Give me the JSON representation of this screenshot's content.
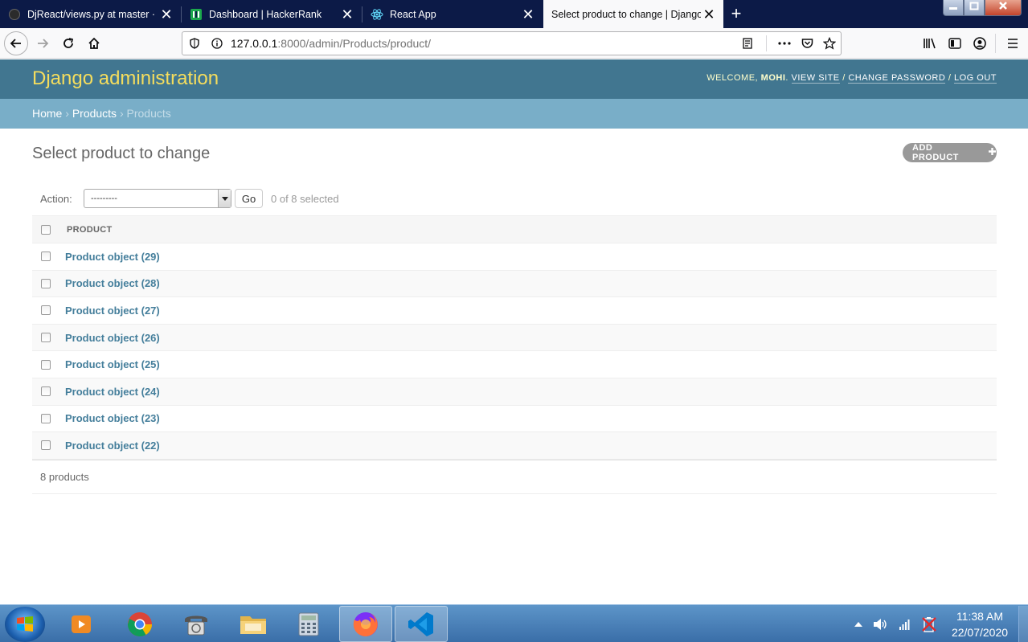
{
  "browser": {
    "tabs": [
      {
        "title": "DjReact/views.py at master · m",
        "icon": "github-icon"
      },
      {
        "title": "Dashboard | HackerRank",
        "icon": "hackerrank-icon"
      },
      {
        "title": "React App",
        "icon": "react-icon"
      },
      {
        "title": "Select product to change | Django",
        "icon": "none",
        "active": true
      }
    ],
    "close_glyph": "✕",
    "new_tab_glyph": "+",
    "url_host": "127.0.0.1",
    "url_path": ":8000/admin/Products/product/"
  },
  "header": {
    "branding": "Django administration",
    "welcome": "Welcome,",
    "username": "mohi",
    "view_site": "View site",
    "change_password": "Change password",
    "log_out": "Log out"
  },
  "breadcrumbs": {
    "home": "Home",
    "app": "Products",
    "current": "Products"
  },
  "content": {
    "title": "Select product to change",
    "add_button": "Add product",
    "action_label": "Action:",
    "action_value": "---------",
    "go_button": "Go",
    "selected_count": "0 of 8 selected",
    "column_header": "Product",
    "rows": [
      "Product object (29)",
      "Product object (28)",
      "Product object (27)",
      "Product object (26)",
      "Product object (25)",
      "Product object (24)",
      "Product object (23)",
      "Product object (22)"
    ],
    "paginator": "8 products"
  },
  "taskbar": {
    "time": "11:38 AM",
    "date": "22/07/2020"
  },
  "colors": {
    "header_bg": "#417690",
    "breadcrumb_bg": "#79aec8",
    "branding": "#f5dd5d",
    "link": "#447e9b",
    "tabstrip": "#0c1a47"
  }
}
